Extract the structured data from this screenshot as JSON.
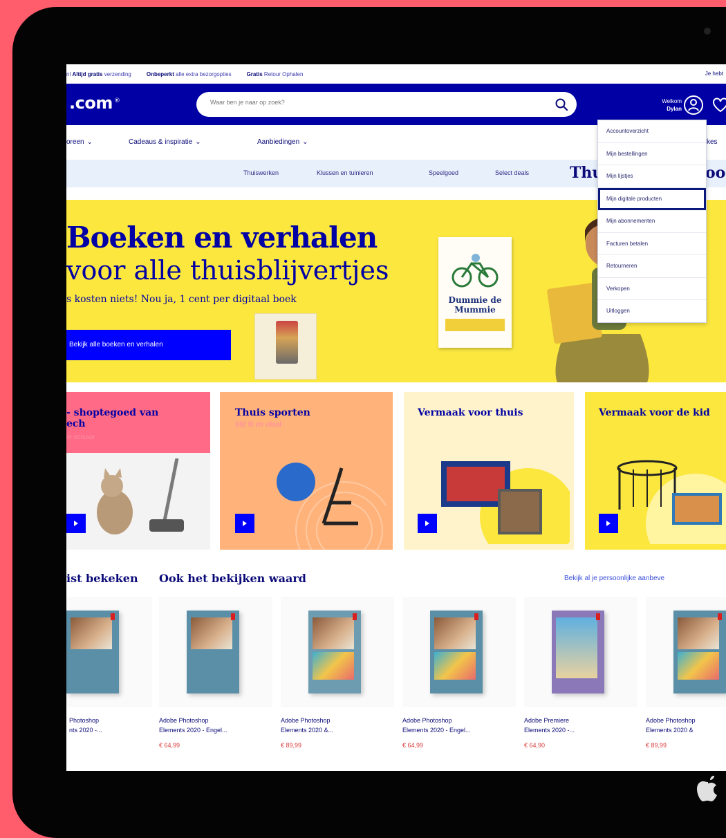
{
  "usp_bar": {
    "item1_prefix": "nl",
    "item1_bold": "Altijd gratis",
    "item1_rest": " verzending",
    "item2_bold": "Onbeperkt",
    "item2_rest": " alle extra bezorgopties",
    "item3_bold": "Gratis",
    "item3_rest": " Retour Ophalen",
    "right_text": "Je hebt"
  },
  "header": {
    "logo": ".com",
    "search_placeholder": "Waar ben je naar op zoek?",
    "welcome_label": "Welkom",
    "user_name": "Dylan"
  },
  "category_nav": {
    "items": [
      "oreen",
      "Cadeaus & inspiratie",
      "Aanbiedingen"
    ],
    "extra": "kes"
  },
  "sub_nav": {
    "links": [
      "Thuiswerken",
      "Klussen en tuinieren",
      "Speelgoed",
      "Select deals"
    ],
    "highlight": "Thu",
    "highlight_right": "oo"
  },
  "account_menu": {
    "items": [
      "Accountoverzicht",
      "Mijn bestellingen",
      "Mijn lijstjes",
      "Mijn digitale producten",
      "Mijn abonnementen",
      "Facturen betalen",
      "Retourneren",
      "Verkopen",
      "Uitloggen"
    ],
    "active_index": 3
  },
  "hero": {
    "title": "Boeken en verhalen",
    "subtitle": "voor alle thuisblijvertjes",
    "note": "s kosten niets! Nou ja, 1 cent per digitaal boek",
    "cta": "Bekijk alle boeken en verhalen",
    "book_title": "Dummie de Mummie"
  },
  "promo_tiles": [
    {
      "title": "- shoptegoed van",
      "title2": "ech",
      "subtitle": "ie scissor"
    },
    {
      "title": "Thuis sporten",
      "subtitle": "Blijf fit en vitaal"
    },
    {
      "title": "Vermaak voor thuis",
      "subtitle": ""
    },
    {
      "title": "Vermaak voor de kid",
      "subtitle": ""
    }
  ],
  "recent": {
    "heading_left": "ist bekeken",
    "heading": "Ook het bekijken waard",
    "see_all": "Bekijk al je persoonlijke aanbeve"
  },
  "products": [
    {
      "name1": "Photoshop",
      "name2": "nts 2020 -...",
      "price": ""
    },
    {
      "name1": "Adobe Photoshop",
      "name2": "Elements 2020 - Engel...",
      "price": "€ 64,99"
    },
    {
      "name1": "Adobe Photoshop",
      "name2": "Elements 2020 &...",
      "price": "€ 89,99"
    },
    {
      "name1": "Adobe Photoshop",
      "name2": "Elements 2020 - Engel...",
      "price": "€ 64,99"
    },
    {
      "name1": "Adobe Premiere",
      "name2": "Elements 2020 -...",
      "price": "€ 64,90"
    },
    {
      "name1": "Adobe Photoshop",
      "name2": "Elements 2020 &",
      "price": "€ 89,99"
    }
  ],
  "colors": {
    "background": "#ff5c6c",
    "brand_blue": "#0000a4",
    "hero_yellow": "#fbe73e",
    "price_red": "#d93a3a"
  }
}
